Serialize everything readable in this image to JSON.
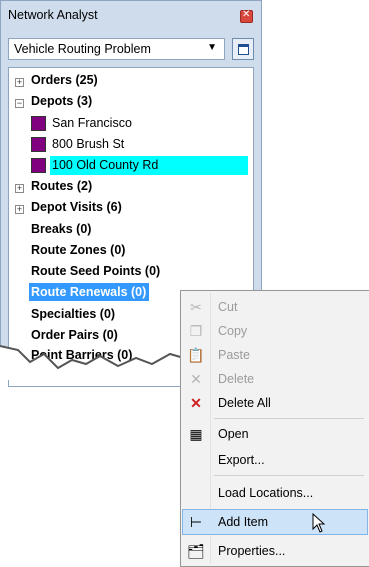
{
  "panel": {
    "title": "Network Analyst",
    "problem_selector": "Vehicle Routing Problem"
  },
  "tree": {
    "orders": "Orders (25)",
    "depots": "Depots (3)",
    "depot_items": [
      "San Francisco",
      "800 Brush St",
      "100 Old County Rd"
    ],
    "routes": "Routes (2)",
    "depot_visits": "Depot Visits (6)",
    "breaks": "Breaks (0)",
    "route_zones": "Route Zones (0)",
    "route_seed_points": "Route Seed Points (0)",
    "route_renewals": "Route Renewals (0)",
    "specialties": "Specialties (0)",
    "order_pairs": "Order Pairs (0)",
    "point_barriers": "Point Barriers (0)"
  },
  "menu": {
    "items": [
      "Cut",
      "Copy",
      "Paste",
      "Delete",
      "Delete All",
      "Open",
      "Export...",
      "Load Locations...",
      "Add Item",
      "Properties..."
    ]
  },
  "colors": {
    "depot_swatch": "#800080",
    "highlight_cyan": "#00ffff",
    "selection_blue": "#3399ff",
    "panel_bg": "#cfdcec",
    "menu_hover": "#cde3f8"
  }
}
